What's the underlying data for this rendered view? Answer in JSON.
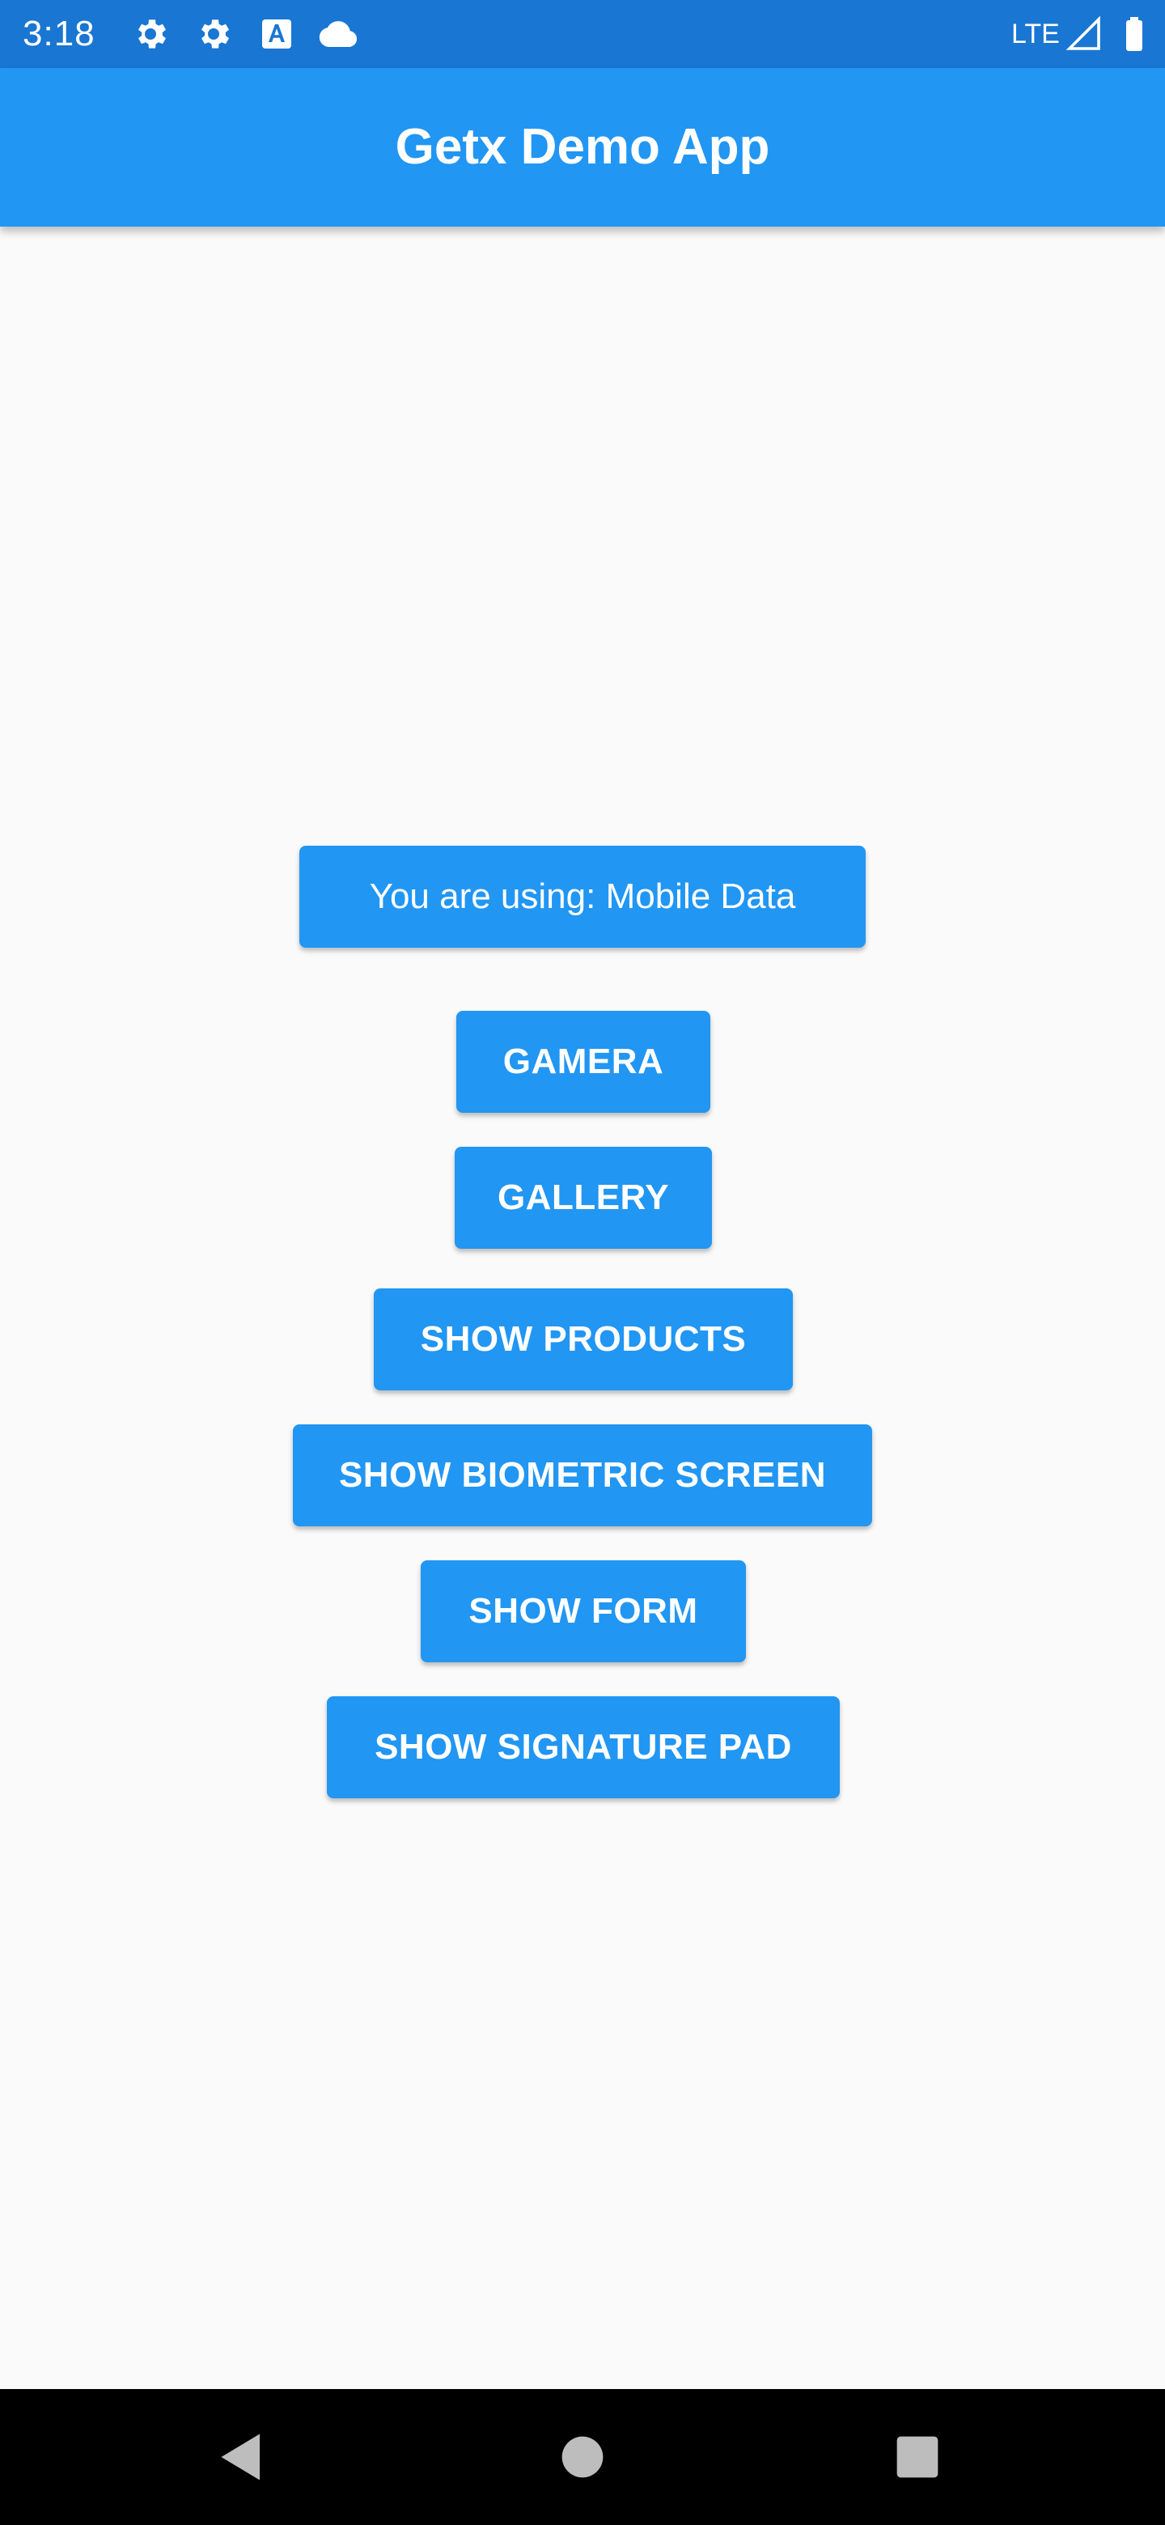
{
  "status_bar": {
    "time": "3:18",
    "network": "LTE",
    "icons": [
      "gear-icon",
      "gear-icon",
      "text-a-icon",
      "cloud-icon",
      "signal-icon",
      "battery-icon"
    ]
  },
  "app_bar": {
    "title": "Getx Demo App"
  },
  "main": {
    "connection_button": "You are using: Mobile Data",
    "camera_button": "GAMERA",
    "gallery_button": "GALLERY",
    "products_button": "SHOW PRODUCTS",
    "biometric_button": "SHOW BIOMETRIC SCREEN",
    "form_button": "SHOW FORM",
    "signature_button": "SHOW SIGNATURE PAD"
  },
  "navigation": {
    "icons": [
      "back-icon",
      "home-icon",
      "recents-icon"
    ]
  },
  "colors": {
    "status_bar": "#1976d2",
    "primary": "#2196f3",
    "background": "#fafafa",
    "nav_bar": "#000000",
    "text_on_primary": "#ffffff"
  }
}
